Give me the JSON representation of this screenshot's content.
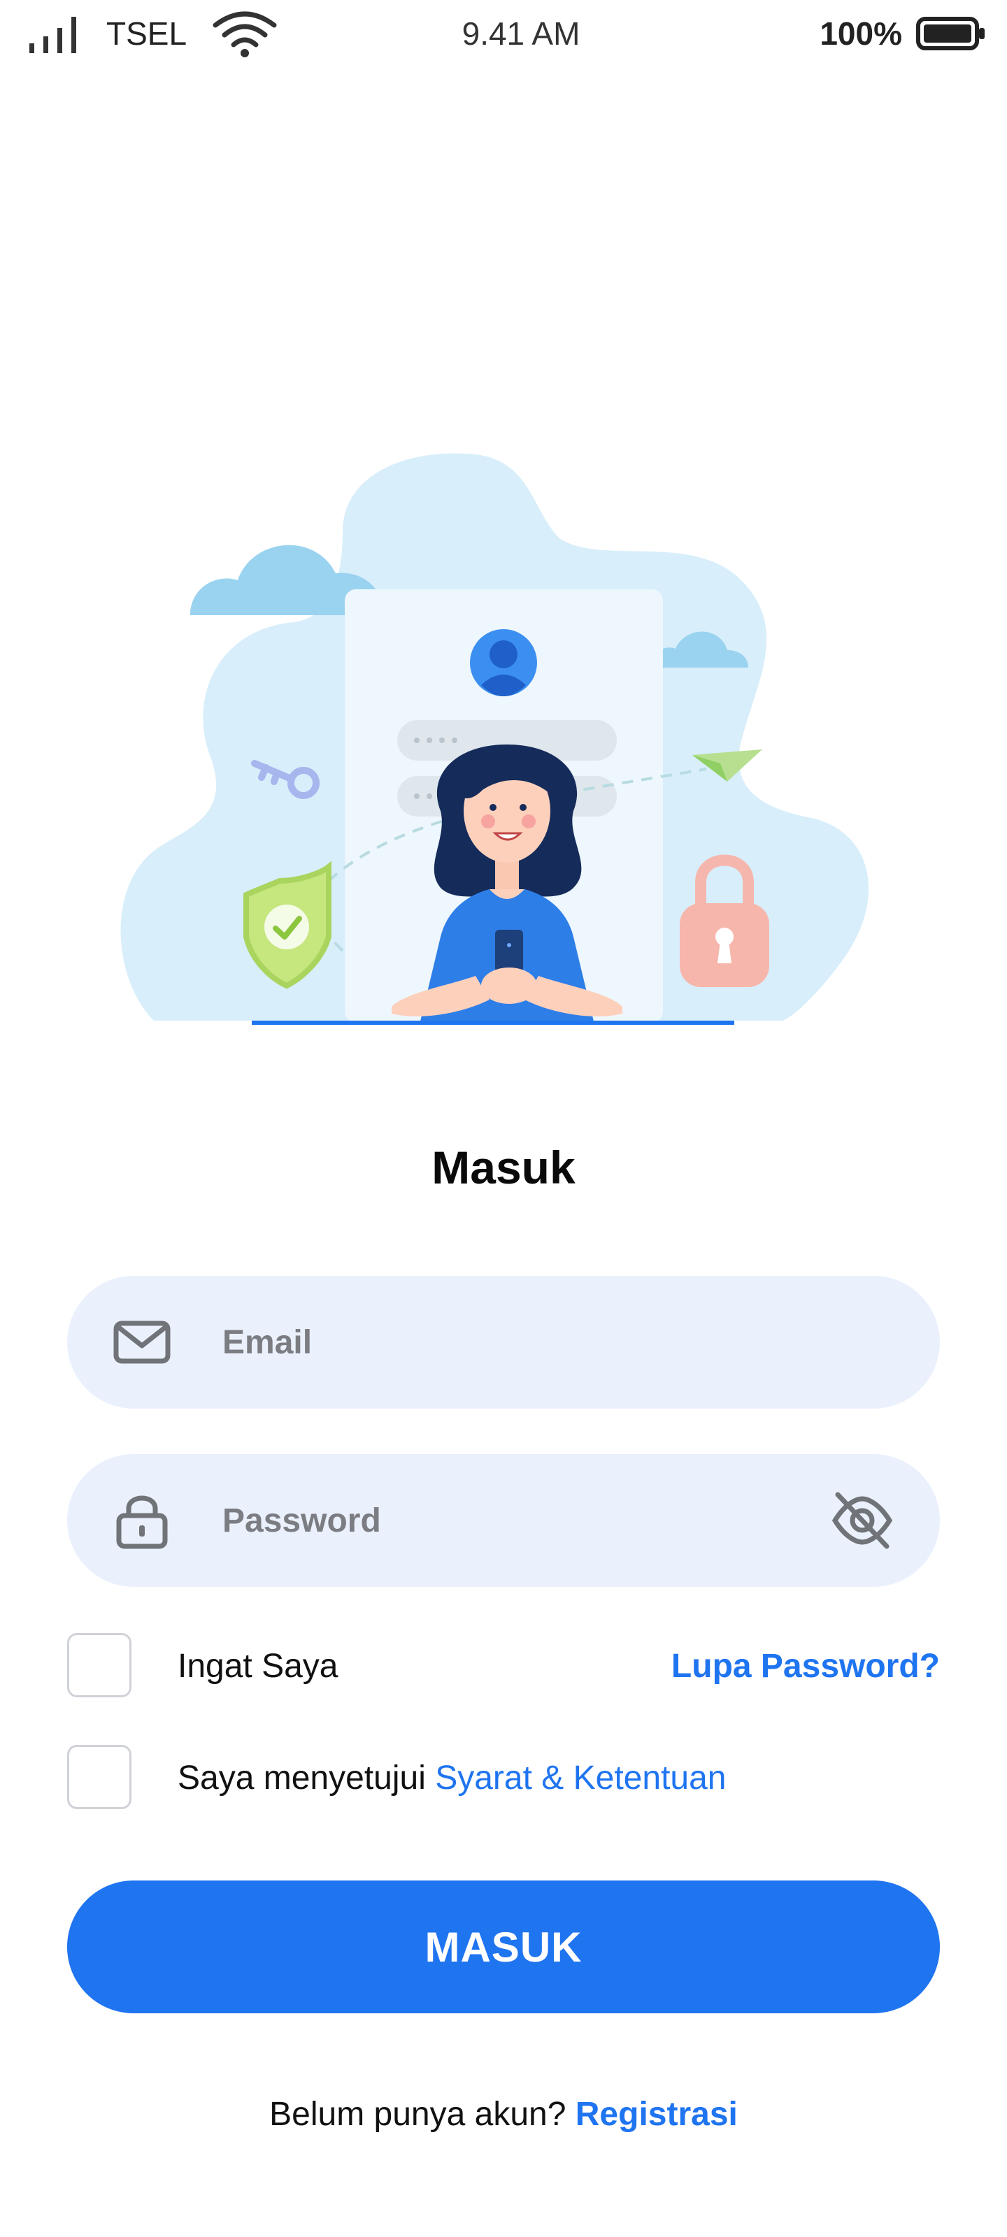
{
  "status_bar": {
    "carrier": "TSEL",
    "time": "9.41 AM",
    "battery_percent": "100%",
    "battery_level": 1.0,
    "icons": [
      "signal-icon",
      "wifi-icon",
      "battery-icon"
    ]
  },
  "illustration": {
    "icon": "login-illustration"
  },
  "login": {
    "title": "Masuk",
    "email_placeholder": "Email",
    "email_value": "",
    "password_placeholder": "Password",
    "password_value": "",
    "remember_label": "Ingat Saya",
    "remember_checked": false,
    "forgot_label": "Lupa Password?",
    "terms_prefix": "Saya menyetujui",
    "terms_link": "Syarat & Ketentuan",
    "terms_checked": false,
    "submit_label": "MASUK",
    "footer_prefix": "Belum punya akun?",
    "footer_link": "Registrasi"
  },
  "colors": {
    "accent": "#1f74f0",
    "field_bg": "#eaf1fd",
    "text": "#111111",
    "placeholder": "#7b7d82"
  }
}
